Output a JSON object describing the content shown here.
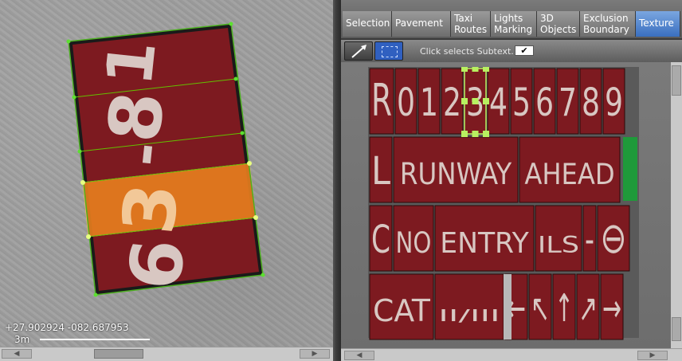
{
  "map": {
    "coordinates": "+27.902924 -082.687953",
    "scale_label": "3m",
    "sign_panels": [
      "1",
      "8",
      "-",
      "3",
      "6"
    ]
  },
  "tabs": [
    {
      "label": "Selection"
    },
    {
      "label": "Pavement"
    },
    {
      "label": "Taxi Routes"
    },
    {
      "label": "Lights Marking"
    },
    {
      "label": "3D Objects"
    },
    {
      "label": "Exclusion Boundary"
    },
    {
      "label": "Texture",
      "active": true
    }
  ],
  "toolbar": {
    "hint": "Click selects Subtext...",
    "checkbox_mark": "✔"
  },
  "texture_sheet": {
    "row1": [
      "R",
      "0",
      "1",
      "2",
      "3",
      "4",
      "5",
      "6",
      "7",
      "8",
      "9"
    ],
    "row2": [
      "L",
      "RUNWAY",
      "AHEAD"
    ],
    "row3": [
      "C",
      "NO",
      "ENTRY",
      "ILS",
      "-",
      "⊖"
    ],
    "row4": [
      "CAT",
      "II/III",
      "←",
      "↖",
      "↑",
      "↗",
      "→"
    ]
  },
  "colors": {
    "sign_red": "#7d1a20",
    "sign_text": "#d8c7c2",
    "selected_overlay": "#e8801e",
    "active_tab": "#3a6fc0",
    "handle_green": "#b8f060"
  }
}
